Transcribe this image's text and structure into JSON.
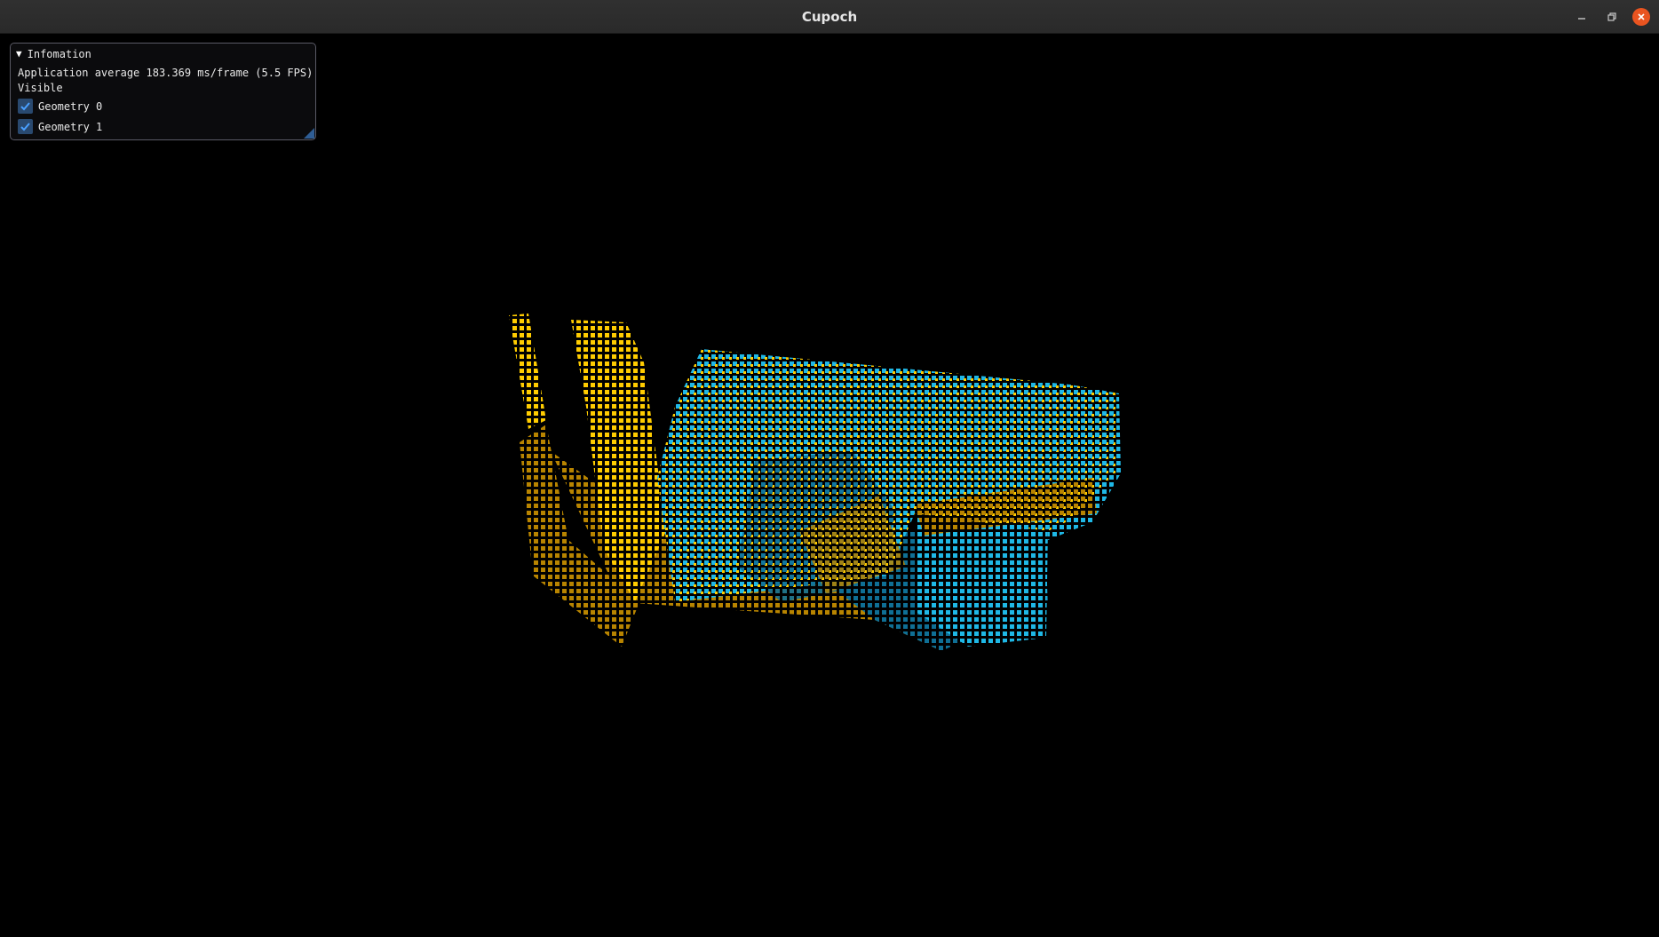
{
  "window": {
    "title": "Cupoch",
    "controls": {
      "minimize": "minimize-icon",
      "maximize": "restore-icon",
      "close": "close-icon"
    },
    "accent_close": "#e95420"
  },
  "info_panel": {
    "header": "Infomation",
    "collapse_icon": "triangle-down-icon",
    "average_text": "Application average 183.369 ms/frame (5.5 FPS)",
    "visible_label": "Visible",
    "geometries": [
      {
        "label": "Geometry 0",
        "checked": true
      },
      {
        "label": "Geometry 1",
        "checked": true
      }
    ],
    "checkbox_color": "#29496f"
  },
  "scene": {
    "background": "#000000",
    "point_colors": {
      "geometry_0_light": "#ffcc00",
      "geometry_0_shadow": "#b88400",
      "geometry_1_light": "#1fb8e6",
      "geometry_1_shadow": "#0f6f95"
    }
  }
}
